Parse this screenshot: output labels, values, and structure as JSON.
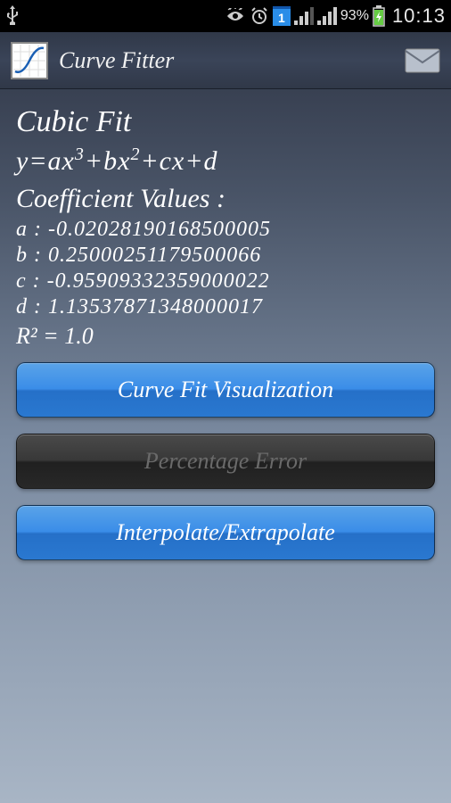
{
  "status": {
    "battery_percent": "93%",
    "time": "10:13",
    "calendar_day": "1"
  },
  "header": {
    "app_title": "Curve Fitter"
  },
  "content": {
    "fit_title": "Cubic Fit",
    "equation_html": "y=ax<sup>3</sup>+bx<sup>2</sup>+cx+d",
    "coef_header": "Coefficient Values :",
    "coef_a": "a : -0.02028190168500005",
    "coef_b": "b : 0.25000251179500066",
    "coef_c": "c : -0.95909332359000022",
    "coef_d": "d : 1.13537871348000017",
    "r_squared": "R² = 1.0"
  },
  "buttons": {
    "visualize": "Curve Fit Visualization",
    "percent_error": "Percentage Error",
    "interpolate": "Interpolate/Extrapolate"
  }
}
